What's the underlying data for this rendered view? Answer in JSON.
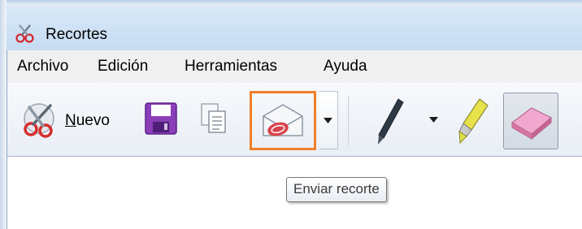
{
  "window": {
    "title": "Recortes",
    "icon": "scissors-icon"
  },
  "menubar": {
    "items": [
      "Archivo",
      "Edición",
      "Herramientas",
      "Ayuda"
    ]
  },
  "toolbar": {
    "new_label_underlined": "N",
    "new_label_rest": "uevo",
    "new_icon": "scissors-icon",
    "save_icon": "floppy-disk-icon",
    "copy_icon": "copy-icon",
    "send_icon": "envelope-icon",
    "send_dropdown_icon": "triangle-down-icon",
    "pen_icon": "pen-icon",
    "pen_dropdown_icon": "triangle-down-icon",
    "highlighter_icon": "highlighter-icon",
    "eraser_icon": "eraser-icon",
    "highlight_color": "#f07f2a"
  },
  "tooltip": {
    "text": "Enviar recorte"
  }
}
